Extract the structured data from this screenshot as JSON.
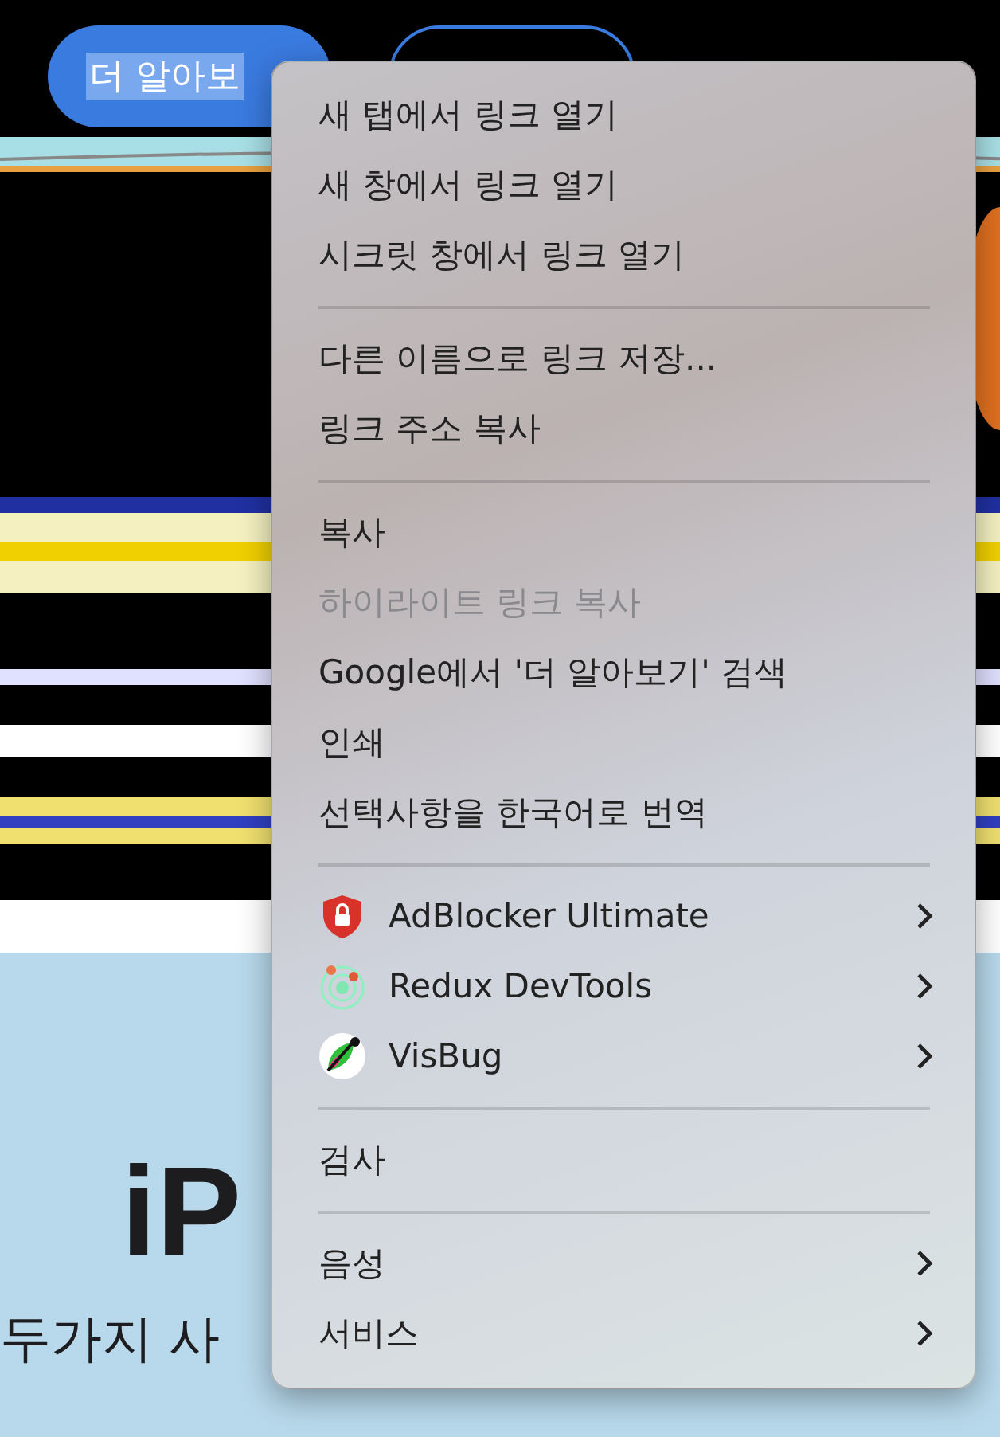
{
  "page": {
    "buttons": [
      {
        "kind": "filled",
        "label": "더 알아보",
        "text_selected": true
      },
      {
        "kind": "outline"
      }
    ],
    "headline": "iP",
    "subtitle": "두가지 사"
  },
  "context_menu": {
    "sections": [
      {
        "items": [
          {
            "kind": "text",
            "label": "새 탭에서 링크 열기",
            "disabled": false,
            "submenu": false
          },
          {
            "kind": "text",
            "label": "새 창에서 링크 열기",
            "disabled": false,
            "submenu": false
          },
          {
            "kind": "text",
            "label": "시크릿 창에서 링크 열기",
            "disabled": false,
            "submenu": false
          }
        ]
      },
      {
        "items": [
          {
            "kind": "text",
            "label": "다른 이름으로 링크 저장...",
            "disabled": false,
            "submenu": false
          },
          {
            "kind": "text",
            "label": "링크 주소 복사",
            "disabled": false,
            "submenu": false
          }
        ]
      },
      {
        "items": [
          {
            "kind": "text",
            "label": "복사",
            "disabled": false,
            "submenu": false
          },
          {
            "kind": "text",
            "label": "하이라이트 링크 복사",
            "disabled": true,
            "submenu": false
          },
          {
            "kind": "text",
            "label": "Google에서 '더 알아보기' 검색",
            "disabled": false,
            "submenu": false
          },
          {
            "kind": "text",
            "label": "인쇄",
            "disabled": false,
            "submenu": false
          },
          {
            "kind": "text",
            "label": "선택사항을 한국어로 번역",
            "disabled": false,
            "submenu": false
          }
        ]
      },
      {
        "items": [
          {
            "kind": "shield",
            "label": "AdBlocker Ultimate",
            "disabled": false,
            "submenu": true
          },
          {
            "kind": "rings",
            "label": "Redux DevTools",
            "disabled": false,
            "submenu": true
          },
          {
            "kind": "leaf",
            "label": "VisBug",
            "disabled": false,
            "submenu": true
          }
        ]
      },
      {
        "items": [
          {
            "kind": "text",
            "label": "검사",
            "disabled": false,
            "submenu": false
          }
        ]
      },
      {
        "items": [
          {
            "kind": "text",
            "label": "음성",
            "disabled": false,
            "submenu": true
          },
          {
            "kind": "text",
            "label": "서비스",
            "disabled": false,
            "submenu": true
          }
        ]
      }
    ]
  }
}
